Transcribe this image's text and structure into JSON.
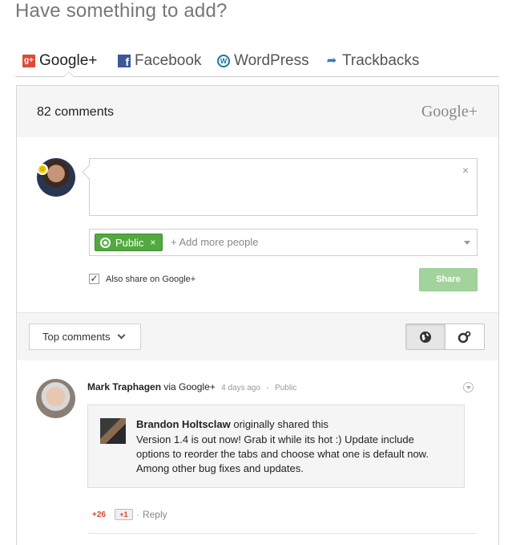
{
  "heading": "Have something to add?",
  "tabs": [
    {
      "label": "Google+",
      "icon": "google-plus-icon"
    },
    {
      "label": "Facebook",
      "icon": "facebook-icon"
    },
    {
      "label": "WordPress",
      "icon": "wordpress-icon"
    },
    {
      "label": "Trackbacks",
      "icon": "trackbacks-icon"
    }
  ],
  "panel": {
    "comment_count": "82 comments",
    "provider_logo": "Google+"
  },
  "compose": {
    "clear": "×",
    "audience_chip": "Public",
    "chip_remove": "×",
    "add_people_placeholder": "+ Add more people",
    "also_share_label": "Also share on Google+",
    "also_share_checked": true,
    "share_button": "Share"
  },
  "sort": {
    "label": "Top comments"
  },
  "comments": [
    {
      "author": "Mark Traphagen",
      "via": "via Google+",
      "time": "4 days ago",
      "visibility": "Public",
      "reshare": {
        "author": "Brandon Holtsclaw",
        "action": "originally shared this",
        "text": "Version 1.4 is out now! Grab it while its hot :) Update include options to reorder the tabs and choose what one is default now. Among other bug fixes and updates."
      },
      "plus_count": "+26",
      "plus_one": "+1",
      "reply": "Reply"
    }
  ],
  "colors": {
    "gplus_red": "#dd4b39",
    "share_green": "#a3d39c",
    "public_chip": "#53a93f"
  }
}
